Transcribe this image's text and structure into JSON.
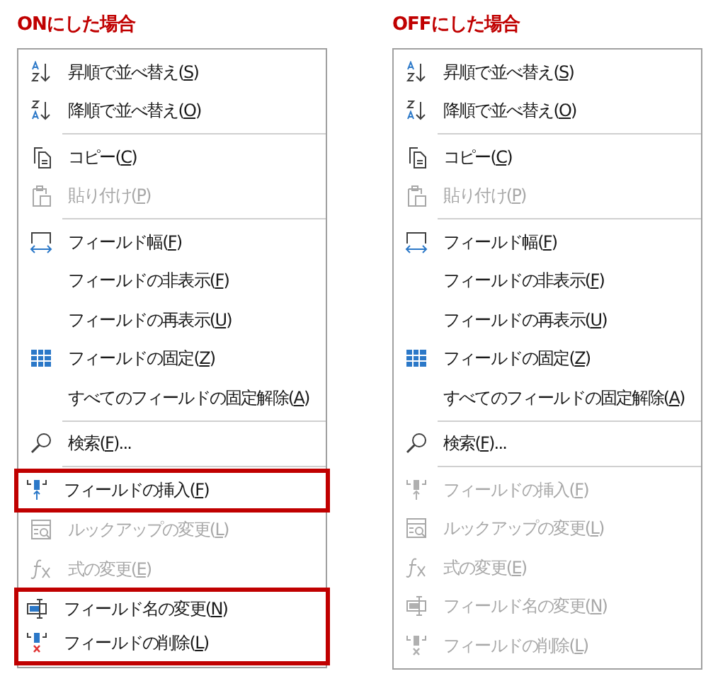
{
  "menus": [
    {
      "title": "ONにした場合",
      "items": [
        {
          "kind": "sort_asc",
          "before": "昇順で並べ替え(",
          "key": "S",
          "after": ")",
          "disabled": false,
          "highlighted": false,
          "separator_before": false
        },
        {
          "kind": "sort_desc",
          "before": "降順で並べ替え(",
          "key": "O",
          "after": ")",
          "disabled": false,
          "highlighted": false,
          "separator_before": false
        },
        {
          "kind": "copy",
          "before": "コピー(",
          "key": "C",
          "after": ")",
          "disabled": false,
          "highlighted": false,
          "separator_before": true
        },
        {
          "kind": "paste",
          "before": "貼り付け(",
          "key": "P",
          "after": ")",
          "disabled": true,
          "highlighted": false,
          "separator_before": false
        },
        {
          "kind": "width",
          "before": "フィールド幅(",
          "key": "F",
          "after": ")",
          "disabled": false,
          "highlighted": false,
          "separator_before": true
        },
        {
          "kind": "none",
          "before": "フィールドの非表示(",
          "key": "F",
          "after": ")",
          "disabled": false,
          "highlighted": false,
          "separator_before": false
        },
        {
          "kind": "none",
          "before": "フィールドの再表示(",
          "key": "U",
          "after": ")",
          "disabled": false,
          "highlighted": false,
          "separator_before": false
        },
        {
          "kind": "freeze",
          "before": "フィールドの固定(",
          "key": "Z",
          "after": ")",
          "disabled": false,
          "highlighted": false,
          "separator_before": false
        },
        {
          "kind": "none",
          "before": "すべてのフィールドの固定解除(",
          "key": "A",
          "after": ")",
          "disabled": false,
          "highlighted": false,
          "separator_before": false
        },
        {
          "kind": "search",
          "before": "検索(",
          "key": "F",
          "after": ")...",
          "disabled": false,
          "highlighted": false,
          "separator_before": true
        },
        {
          "kind": "insert",
          "before": "フィールドの挿入(",
          "key": "F",
          "after": ")",
          "disabled": false,
          "highlighted": true,
          "separator_before": true
        },
        {
          "kind": "lookup",
          "before": "ルックアップの変更(",
          "key": "L",
          "after": ")",
          "disabled": true,
          "highlighted": false,
          "separator_before": false
        },
        {
          "kind": "fx",
          "before": "式の変更(",
          "key": "E",
          "after": ")",
          "disabled": true,
          "highlighted": false,
          "separator_before": false
        },
        {
          "kind": "rename",
          "before": "フィールド名の変更(",
          "key": "N",
          "after": ")",
          "disabled": false,
          "highlighted": true,
          "separator_before": false
        },
        {
          "kind": "delete",
          "before": "フィールドの削除(",
          "key": "L",
          "after": ")",
          "disabled": false,
          "highlighted": true,
          "separator_before": false
        }
      ]
    },
    {
      "title": "OFFにした場合",
      "items": [
        {
          "kind": "sort_asc",
          "before": "昇順で並べ替え(",
          "key": "S",
          "after": ")",
          "disabled": false,
          "highlighted": false,
          "separator_before": false
        },
        {
          "kind": "sort_desc",
          "before": "降順で並べ替え(",
          "key": "O",
          "after": ")",
          "disabled": false,
          "highlighted": false,
          "separator_before": false
        },
        {
          "kind": "copy",
          "before": "コピー(",
          "key": "C",
          "after": ")",
          "disabled": false,
          "highlighted": false,
          "separator_before": true
        },
        {
          "kind": "paste",
          "before": "貼り付け(",
          "key": "P",
          "after": ")",
          "disabled": true,
          "highlighted": false,
          "separator_before": false
        },
        {
          "kind": "width",
          "before": "フィールド幅(",
          "key": "F",
          "after": ")",
          "disabled": false,
          "highlighted": false,
          "separator_before": true
        },
        {
          "kind": "none",
          "before": "フィールドの非表示(",
          "key": "F",
          "after": ")",
          "disabled": false,
          "highlighted": false,
          "separator_before": false
        },
        {
          "kind": "none",
          "before": "フィールドの再表示(",
          "key": "U",
          "after": ")",
          "disabled": false,
          "highlighted": false,
          "separator_before": false
        },
        {
          "kind": "freeze",
          "before": "フィールドの固定(",
          "key": "Z",
          "after": ")",
          "disabled": false,
          "highlighted": false,
          "separator_before": false
        },
        {
          "kind": "none",
          "before": "すべてのフィールドの固定解除(",
          "key": "A",
          "after": ")",
          "disabled": false,
          "highlighted": false,
          "separator_before": false
        },
        {
          "kind": "search",
          "before": "検索(",
          "key": "F",
          "after": ")...",
          "disabled": false,
          "highlighted": false,
          "separator_before": true
        },
        {
          "kind": "insert",
          "before": "フィールドの挿入(",
          "key": "F",
          "after": ")",
          "disabled": true,
          "highlighted": false,
          "separator_before": true
        },
        {
          "kind": "lookup",
          "before": "ルックアップの変更(",
          "key": "L",
          "after": ")",
          "disabled": true,
          "highlighted": false,
          "separator_before": false
        },
        {
          "kind": "fx",
          "before": "式の変更(",
          "key": "E",
          "after": ")",
          "disabled": true,
          "highlighted": false,
          "separator_before": false
        },
        {
          "kind": "rename",
          "before": "フィールド名の変更(",
          "key": "N",
          "after": ")",
          "disabled": true,
          "highlighted": false,
          "separator_before": false
        },
        {
          "kind": "delete",
          "before": "フィールドの削除(",
          "key": "L",
          "after": ")",
          "disabled": true,
          "highlighted": false,
          "separator_before": false
        }
      ]
    }
  ]
}
